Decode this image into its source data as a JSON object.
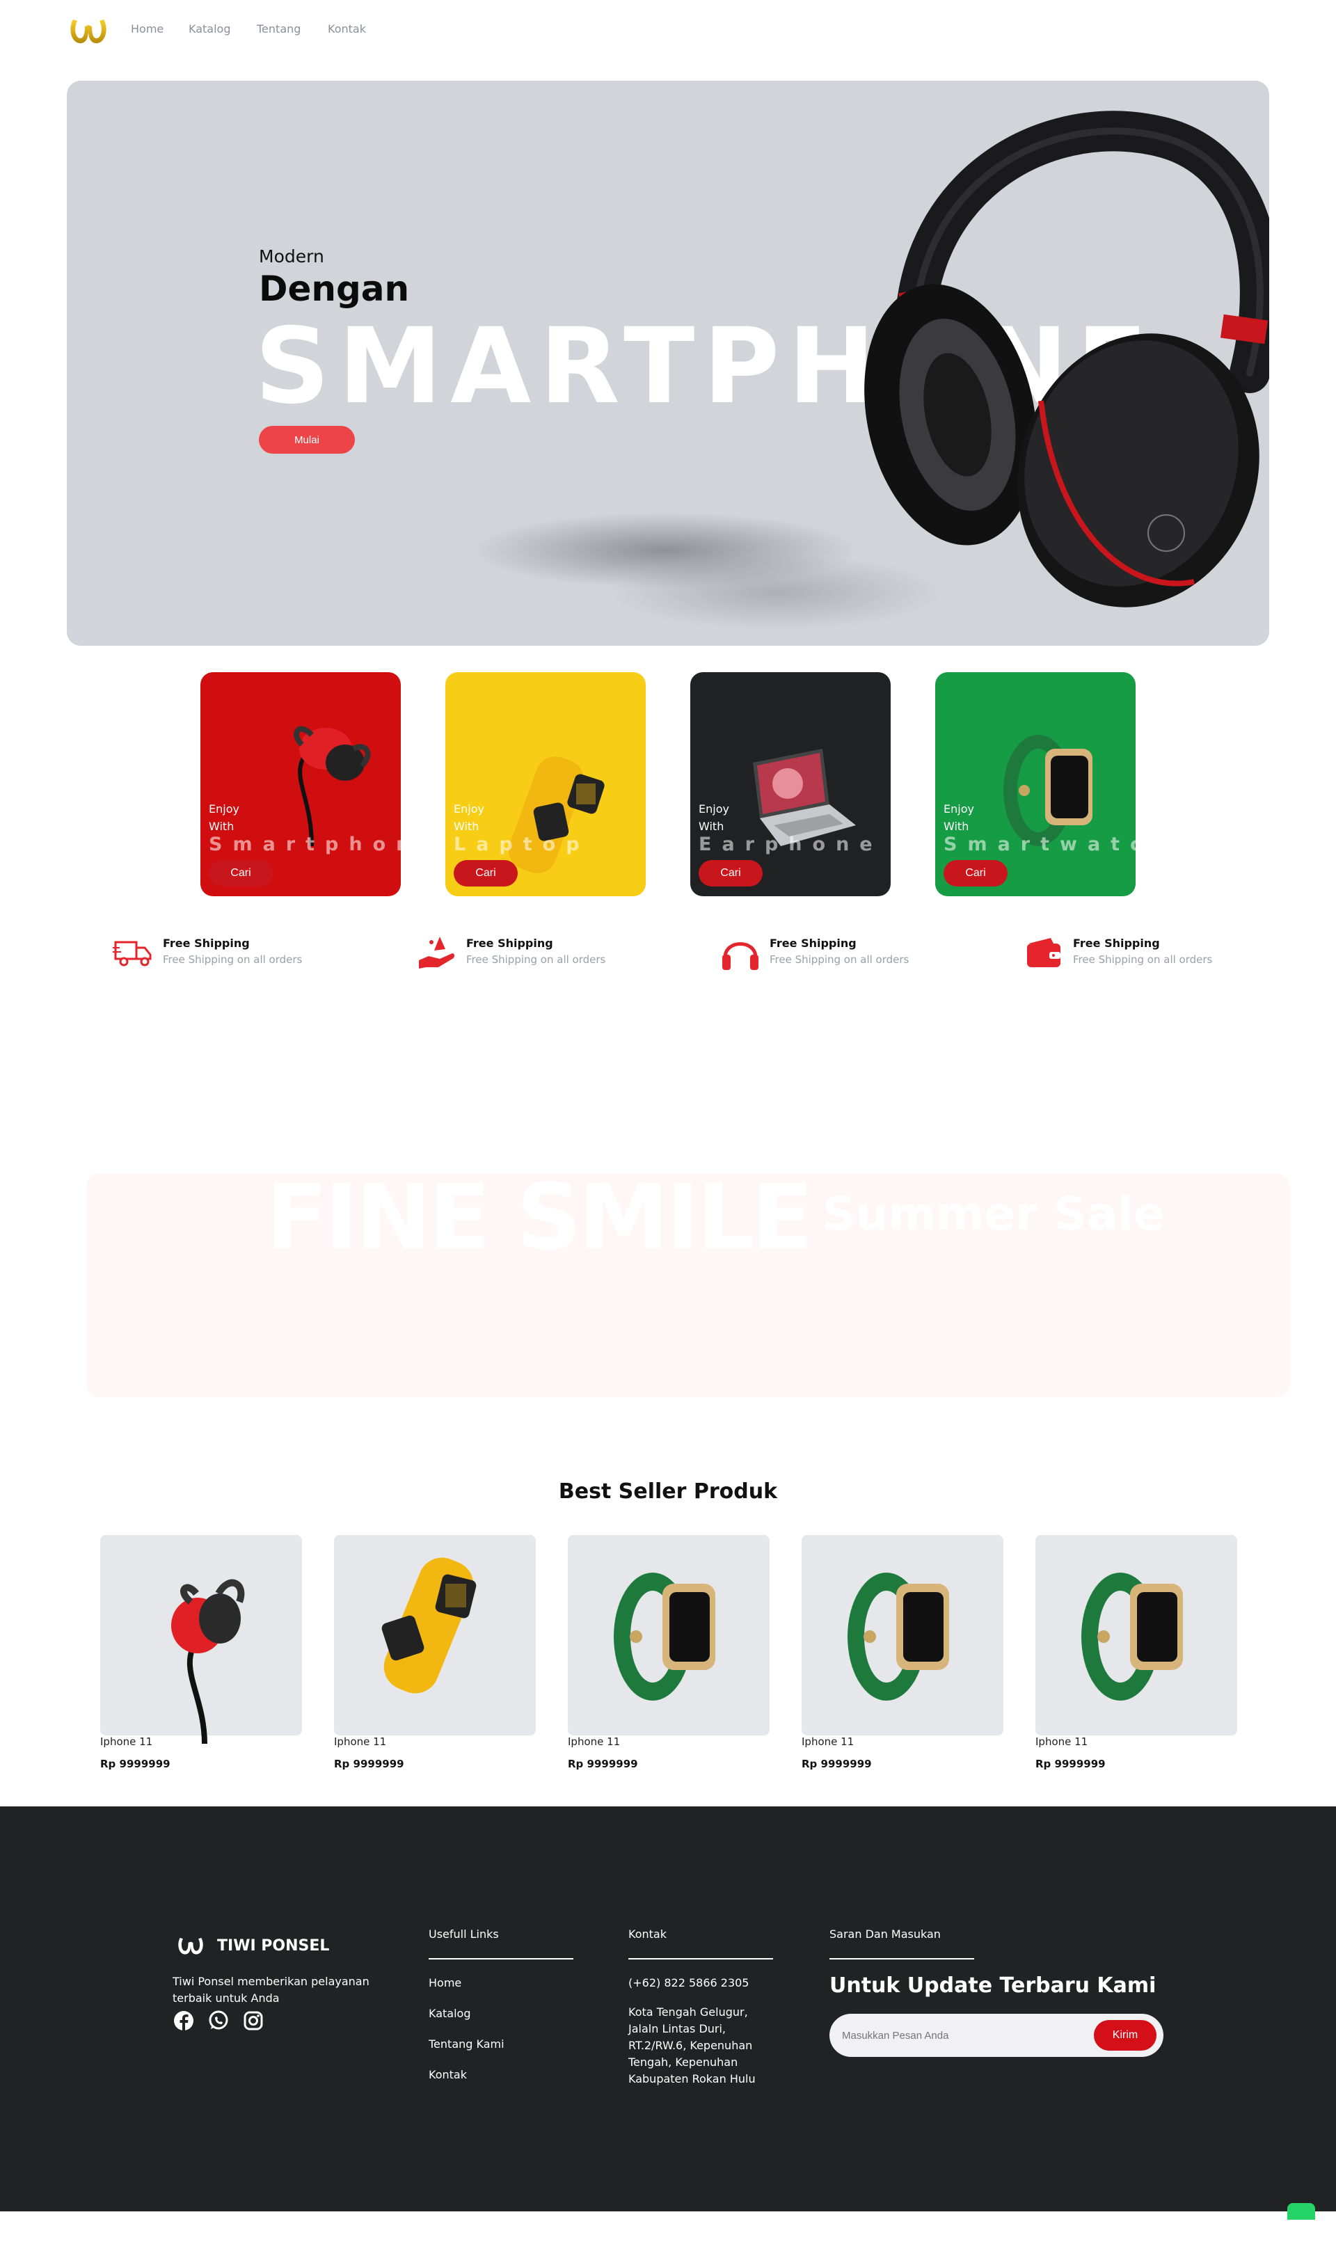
{
  "nav": {
    "links": [
      "Home",
      "Katalog",
      "Tentang",
      "Kontak"
    ]
  },
  "hero": {
    "line1": "Modern",
    "line2": "Dengan",
    "big_word": "SMARTPHONE",
    "cta": "Mulai"
  },
  "category_cards": [
    {
      "line1": "Enjoy",
      "line2": "With",
      "category": "Smartphone",
      "button": "Cari",
      "bg": "#d00d0f",
      "icon": "earphone-icon"
    },
    {
      "line1": "Enjoy",
      "line2": "With",
      "category": "Laptop",
      "button": "Cari",
      "bg": "#f8cd15",
      "icon": "smartwatch-yellow-icon"
    },
    {
      "line1": "Enjoy",
      "line2": "With",
      "category": "Earphone",
      "button": "Cari",
      "bg": "#202122",
      "icon": "laptop-icon"
    },
    {
      "line1": "Enjoy",
      "line2": "With",
      "category": "Smartwatch",
      "button": "Cari",
      "bg": "#169c44",
      "icon": "smartwatch-green-icon"
    }
  ],
  "features": [
    {
      "title": "Free Shipping",
      "subtitle": "Free Shipping on all orders",
      "icon": "truck-icon"
    },
    {
      "title": "Free Shipping",
      "subtitle": "Free Shipping on all orders",
      "icon": "hand-gift-icon"
    },
    {
      "title": "Free Shipping",
      "subtitle": "Free Shipping on all orders",
      "icon": "headphones-icon"
    },
    {
      "title": "Free Shipping",
      "subtitle": "Free Shipping on all orders",
      "icon": "wallet-icon"
    }
  ],
  "banner": {
    "left_text": "FINE SMILE",
    "right_text": "Summer Sale"
  },
  "best_seller": {
    "title": "Best Seller Produk",
    "products": [
      {
        "name": "Iphone 11",
        "price": "Rp 9999999",
        "image": "earphone-icon"
      },
      {
        "name": "Iphone 11",
        "price": "Rp 9999999",
        "image": "smartwatch-yellow-icon"
      },
      {
        "name": "Iphone 11",
        "price": "Rp 9999999",
        "image": "smartwatch-green-icon"
      },
      {
        "name": "Iphone 11",
        "price": "Rp 9999999",
        "image": "smartwatch-green-icon"
      },
      {
        "name": "Iphone 11",
        "price": "Rp 9999999",
        "image": "smartwatch-green-icon"
      }
    ]
  },
  "footer": {
    "brand": "TIWI PONSEL",
    "description": "Tiwi Ponsel memberikan pelayanan terbaik untuk Anda",
    "social": [
      "facebook-icon",
      "whatsapp-icon",
      "instagram-icon"
    ],
    "links_heading": "Usefull Links",
    "links": [
      "Home",
      "Katalog",
      "Tentang Kami",
      "Kontak"
    ],
    "contact_heading": "Kontak",
    "phone": "(+62) 822 5866 2305",
    "address": "Kota Tengah Gelugur, Jalaln Lintas Duri, RT.2/RW.6, Kepenuhan Tengah, Kepenuhan Kabupaten Rokan Hulu",
    "feedback_heading": "Saran Dan Masukan",
    "update_title": "Untuk Update Terbaru Kami",
    "input_placeholder": "Masukkan Pesan Anda",
    "submit": "Kirim"
  },
  "colors": {
    "accent": "#ec4448",
    "footer_bg": "#212223",
    "hero_bg": "#d2d4d9"
  }
}
